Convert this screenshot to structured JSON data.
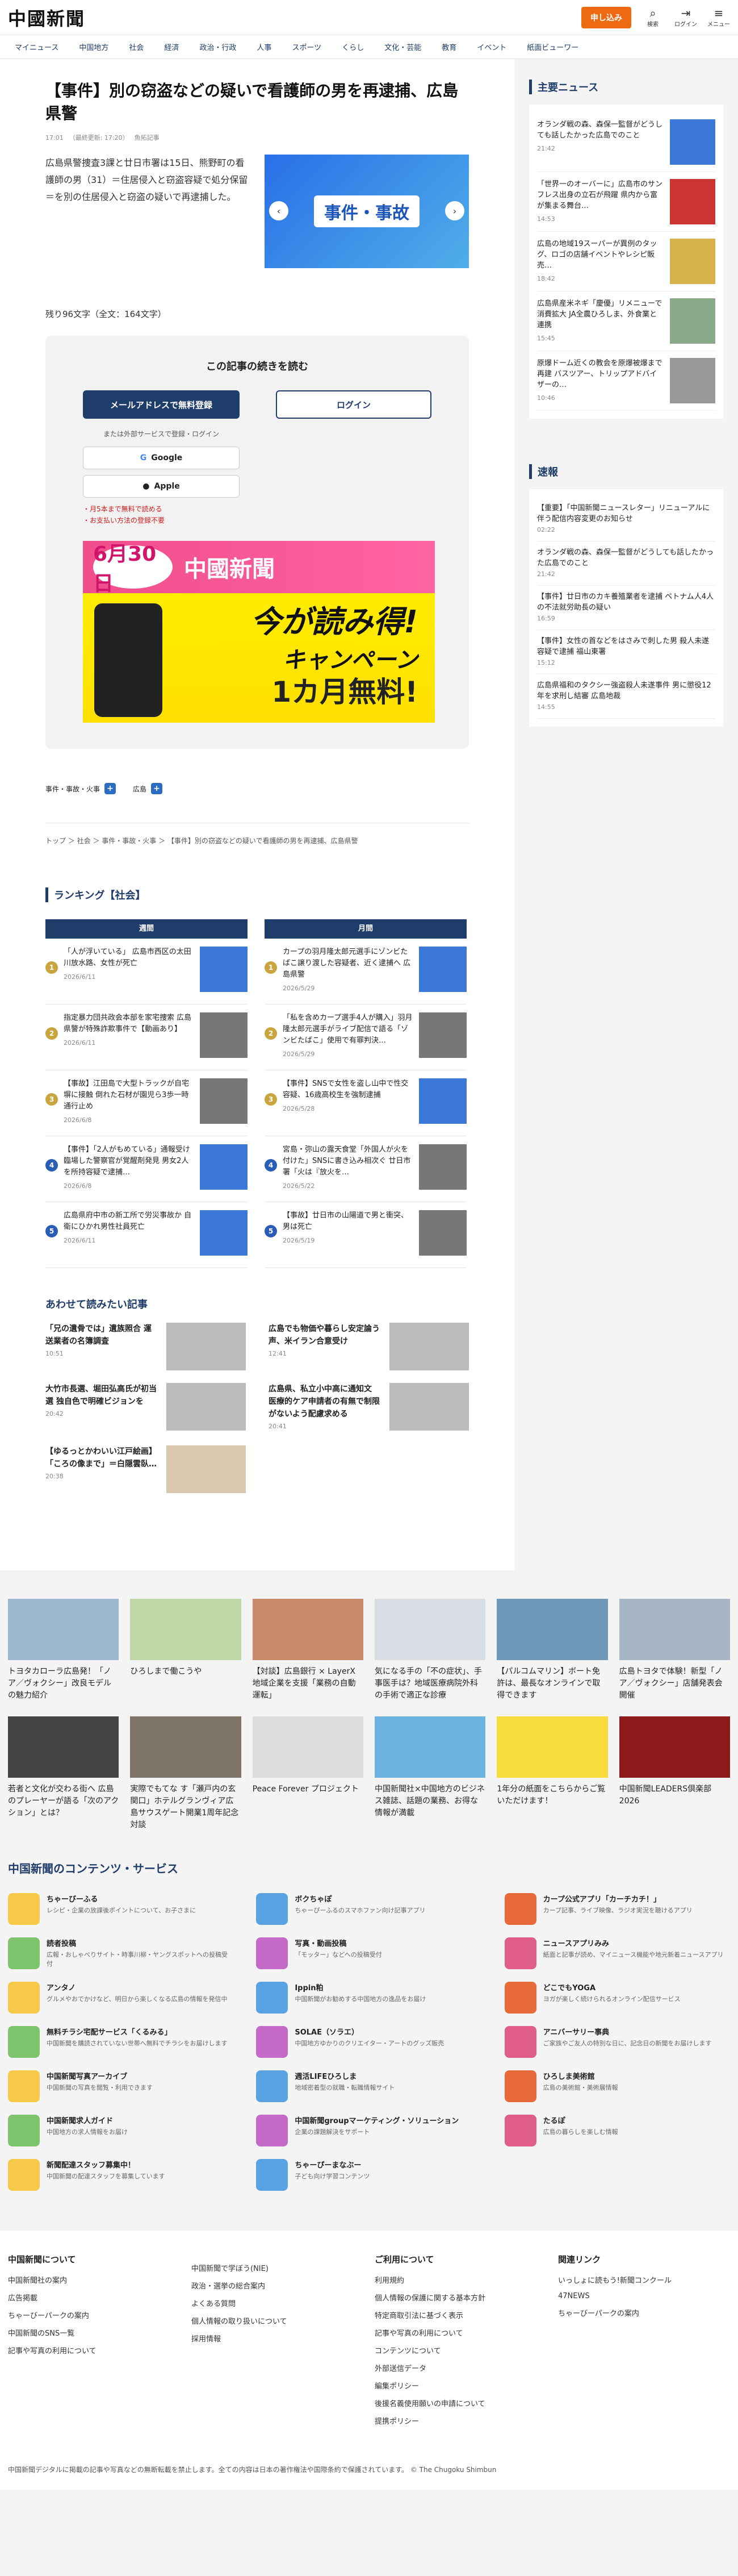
{
  "header": {
    "logo": "中國新聞",
    "subscribe": "申し込み",
    "icons": [
      {
        "name": "search-icon",
        "glyph": "⌕",
        "label": "検索"
      },
      {
        "name": "login-icon",
        "glyph": "⇥",
        "label": "ログイン"
      },
      {
        "name": "menu-icon",
        "glyph": "≡",
        "label": "メニュー"
      }
    ]
  },
  "nav": [
    "マイニュース",
    "中国地方",
    "社会",
    "経済",
    "政治・行政",
    "人事",
    "スポーツ",
    "くらし",
    "文化・芸能",
    "教育",
    "イベント",
    "紙面ビューワー"
  ],
  "article": {
    "title": "【事件】別の窃盗などの疑いで看護師の男を再逮捕、広島県警",
    "time": "17:01",
    "updated": "（最終更新: 17:20）",
    "share": "魚拓記事",
    "lead": "広島県警捜査3課と廿日市署は15日、熊野町の看護師の男（31）＝住居侵入と窃盗容疑で処分保留＝を別の住居侵入と窃盗の疑いで再逮捕した。",
    "slide_tag": "事件・事故",
    "count": "残り96文字（全文：164文字）"
  },
  "paywall": {
    "heading": "この記事の続きを読む",
    "mail_btn": "メールアドレスで無料登録",
    "login_btn": "ログイン",
    "or": "または外部サービスで登録・ログイン",
    "google": "Google",
    "apple": "Apple",
    "note1": "・月5本まで無料で読める",
    "note2": "・お支払い方法の登録不要"
  },
  "campaign": {
    "date": "6月30日",
    "until": "まで",
    "brand": "中國新聞",
    "mid": "今が読み得!",
    "mid2": "キャンペーン",
    "bot": "1カ月無料!"
  },
  "tags": [
    "事件・事故・火事",
    "広島"
  ],
  "breadcrumb": "トップ ＞ 社会 ＞ 事件・事故・火事 ＞ 【事件】別の窃盗などの疑いで看護師の男を再逮捕、広島県警",
  "ranking": {
    "title": "ランキング【社会】",
    "weekly": "週間",
    "monthly": "月間",
    "w": [
      {
        "n": "1",
        "t": "「人が浮いている」 広島市西区の太田川放水路、女性が死亡",
        "d": "2026/6/11"
      },
      {
        "n": "2",
        "t": "指定暴力団共政会本部を家宅捜索 広島県警が特殊詐欺事件で【動画あり】",
        "d": "2026/6/11"
      },
      {
        "n": "3",
        "t": "【事故】江田島で大型トラックが自宅塀に接触 倒れた石材が園児ら3歩一時通行止め",
        "d": "2026/6/8"
      },
      {
        "n": "4",
        "t": "【事件】「2人がもめている」通報受け臨場した警察官が覚醒剤発見 男女2人を所持容疑で逮捕…",
        "d": "2026/6/8"
      },
      {
        "n": "5",
        "t": "広島県府中市の新工所で労災事故か 自衛にひかれ男性社員死亡",
        "d": "2026/6/11"
      }
    ],
    "m": [
      {
        "n": "1",
        "t": "カープの羽月隆太郎元選手にゾンビたばこ譲り渡した容疑者、近く逮捕へ 広島県警",
        "d": "2026/5/29"
      },
      {
        "n": "2",
        "t": "「私を含めカープ選手4人が購入」羽月隆太郎元選手がライブ配信で語る「ゾンビたばこ」使用で有罪判決…",
        "d": "2026/5/29"
      },
      {
        "n": "3",
        "t": "【事件】SNSで女性を盗し山中で性交容疑、16歳高校生を強制逮捕",
        "d": "2026/5/28"
      },
      {
        "n": "4",
        "t": "宮島・弥山の露天食堂「外国人が火を付けた」SNSに書き込み相次ぐ 廿日市署「火は『放火を…",
        "d": "2026/5/22"
      },
      {
        "n": "5",
        "t": "【事故】廿日市の山陽道で男と衝突、男は死亡",
        "d": "2026/5/19"
      }
    ]
  },
  "related": {
    "title": "あわせて読みたい記事",
    "items": [
      {
        "t": "「兄の遺骨では」遺族照合 運送業者の名簿調査",
        "d": "10:51"
      },
      {
        "t": "広島でも物価や暮らし安定論う声、米イラン合意受け",
        "d": "12:41"
      },
      {
        "t": "大竹市長選、堀田弘高氏が初当選 独自色で明確ビジョンを",
        "d": "20:42"
      },
      {
        "t": "広島県、私立小中高に通知文 医療的ケア申請者の有無で制限がないよう配慮求める",
        "d": "20:41"
      },
      {
        "t": "【ゆるっとかわいい江戸絵画】「ころの像まで」＝白隠雲臥…",
        "d": "20:38"
      }
    ]
  },
  "side": {
    "major": "主要ニュース",
    "major_items": [
      {
        "t": "オランダ戦の森、森保一監督がどうしても話したかった広島でのこと",
        "d": "21:42"
      },
      {
        "t": "「世界一のオーバーに」広島市のサンフレス出身の立石が飛躍 県内から富が集まる舞台…",
        "d": "14:53"
      },
      {
        "t": "広島の地域19スーパーが異例のタッグ、ロゴの店舗イベントやレシピ販売…",
        "d": "18:42"
      },
      {
        "t": "広島県産米ネギ「慶優」リメニューで消費拡大 JA全農ひろしま、外食業と連携",
        "d": "15:45"
      },
      {
        "t": "原爆ドーム近くの教会を原爆被爆まで再建 バスツアー、トリップアドバイザーの…",
        "d": "10:46"
      }
    ],
    "flash": "速報",
    "flash_items": [
      {
        "t": "【重要】「中国新聞ニュースレター」リニューアルに伴う配信内容変更のお知らせ",
        "d": "02:22"
      },
      {
        "t": "オランダ戦の森、森保一監督がどうしても話したかった広島でのこと",
        "d": "21:42"
      },
      {
        "t": "【事件】廿日市のカキ養殖業者を逮捕 ベトナム人4人の不法就労助長の疑い",
        "d": "16:59"
      },
      {
        "t": "【事件】女性の首などをはさみで刺した男 殺人未遂容疑で逮捕 福山東署",
        "d": "15:12"
      },
      {
        "t": "広島県福和のタクシー強盗殺人未遂事件 男に懲役12年を求刑し結審 広島地裁",
        "d": "14:55"
      }
    ]
  },
  "promo": [
    {
      "t": "トヨタカローラ広島発！「ノア／ヴォクシー」改良モデルの魅力紹介"
    },
    {
      "t": "ひろしまで働こうや"
    },
    {
      "t": "【対談】広島銀行 × LayerX 地域企業を支援「業務の自動運転」"
    },
    {
      "t": "気になる手の「不の症状」、手事医手は？地域医療病院外科の手術で適正な診療"
    },
    {
      "t": "【パルコムマリン】ボート免許は、最長なオンラインで取得できます"
    },
    {
      "t": "広島トヨタで体験！新型「ノア／ヴォクシー」店舗発表会開催"
    },
    {
      "t": "若者と文化が交わる街へ 広島のプレーヤーが語る「次のアクション」とは？"
    },
    {
      "t": "実際でもてな す「瀬戸内の玄関口」ホテルグランヴィア広島サウスゲート開業1周年記念対談"
    },
    {
      "t": "Peace Forever プロジェクト"
    },
    {
      "t": "中国新聞社×中国地方のビジネス雑誌、話題の業務、お得な情報が満載"
    },
    {
      "t": "1年分の紙面をこちらからご覧いただけます！"
    },
    {
      "t": "中国新聞LEADERS倶楽部2026"
    }
  ],
  "services": {
    "title": "中国新聞のコンテンツ・サービス",
    "items": [
      {
        "n": "ちゃーびーふる",
        "d": "レシピ・企業の放課後ポイントについて、お子さまに"
      },
      {
        "n": "ボクちゃぽ",
        "d": "ちゃーぴーふるのスマホファン向け記事アプリ"
      },
      {
        "n": "カープ公式アプリ「カーチカチ！」",
        "d": "カープ記事、ライブ映像、ラジオ実況を聴けるアプリ"
      },
      {
        "n": "読者投稿",
        "d": "広報・おしゃべりサイト・時事川柳・ヤングスポットへの投稿受付"
      },
      {
        "n": "写真・動画投稿",
        "d": "「モッター」などへの投稿受付"
      },
      {
        "n": "ニュースアプリみみ",
        "d": "紙面と記事が読め、マイニュース機能や地元新着ニュースアプリ"
      },
      {
        "n": "アンタノ",
        "d": "グルメやおでかけなど、明日から楽しくなる広島の情報を発信中"
      },
      {
        "n": "Ippin粕",
        "d": "中国新聞がお勧めする中国地方の逸品をお届け"
      },
      {
        "n": "どこでもYOGA",
        "d": "ヨガが楽しく続けられるオンライン配信サービス"
      },
      {
        "n": "無料チラシ宅配サービス「くるみる」",
        "d": "中国新聞を購読されていない世帯へ無料でチラシをお届けします"
      },
      {
        "n": "SOLAE（ソラエ）",
        "d": "中国地方ゆかりのクリエイター・アートのグッズ販売"
      },
      {
        "n": "アニバーサリー事典",
        "d": "ご家族やご友人の特別な日に、記念日の新聞をお届けします"
      },
      {
        "n": "中国新聞写真アーカイブ",
        "d": "中国新聞の写真を閲覧・利用できます"
      },
      {
        "n": "週活LIFEひろしま",
        "d": "地域密着型の就職・転職情報サイト"
      },
      {
        "n": "ひろしま美術館",
        "d": "広島の美術館・美術展情報"
      },
      {
        "n": "中国新聞求人ガイド",
        "d": "中国地方の求人情報をお届け"
      },
      {
        "n": "中国新聞groupマーケティング・ソリューション",
        "d": "企業の課題解決をサポート"
      },
      {
        "n": "たるぽ",
        "d": "広島の暮らしを楽しむ情報"
      },
      {
        "n": "新聞配達スタッフ募集中！",
        "d": "中国新聞の配達スタッフを募集しています"
      },
      {
        "n": "ちゃーぴーまなぶー",
        "d": "子ども向け学習コンテンツ"
      }
    ]
  },
  "footer": {
    "cols": [
      {
        "h": "中国新聞について",
        "items": [
          "中国新聞社の案内",
          "広告掲載",
          "ちゃーびーパークの案内",
          "中国新聞のSNS一覧",
          "記事や写真の利用について"
        ]
      },
      {
        "h": "",
        "items": [
          "中国新聞で学ぼう(NIE)",
          "政治・選挙の総合案内",
          "よくある質問",
          "個人情報の取り扱いについて",
          "採用情報"
        ]
      },
      {
        "h": "ご利用について",
        "items": [
          "利用規約",
          "個人情報の保護に関する基本方針",
          "特定商取引法に基づく表示",
          "記事や写真の利用について",
          "コンテンツについて",
          "外部送信データ",
          "編集ポリシー",
          "後援名義使用願いの申請について",
          "提携ポリシー"
        ]
      },
      {
        "h": "関連リンク",
        "items": [
          "いっしょに読もう!新聞コンクール",
          "47NEWS",
          "ちゃーびーパークの案内"
        ]
      }
    ]
  },
  "copyright": "中国新聞デジタルに掲載の記事や写真などの無断転載を禁止します。全ての内容は日本の著作権法や国際条約で保護されています。 © The Chugoku Shimbun"
}
